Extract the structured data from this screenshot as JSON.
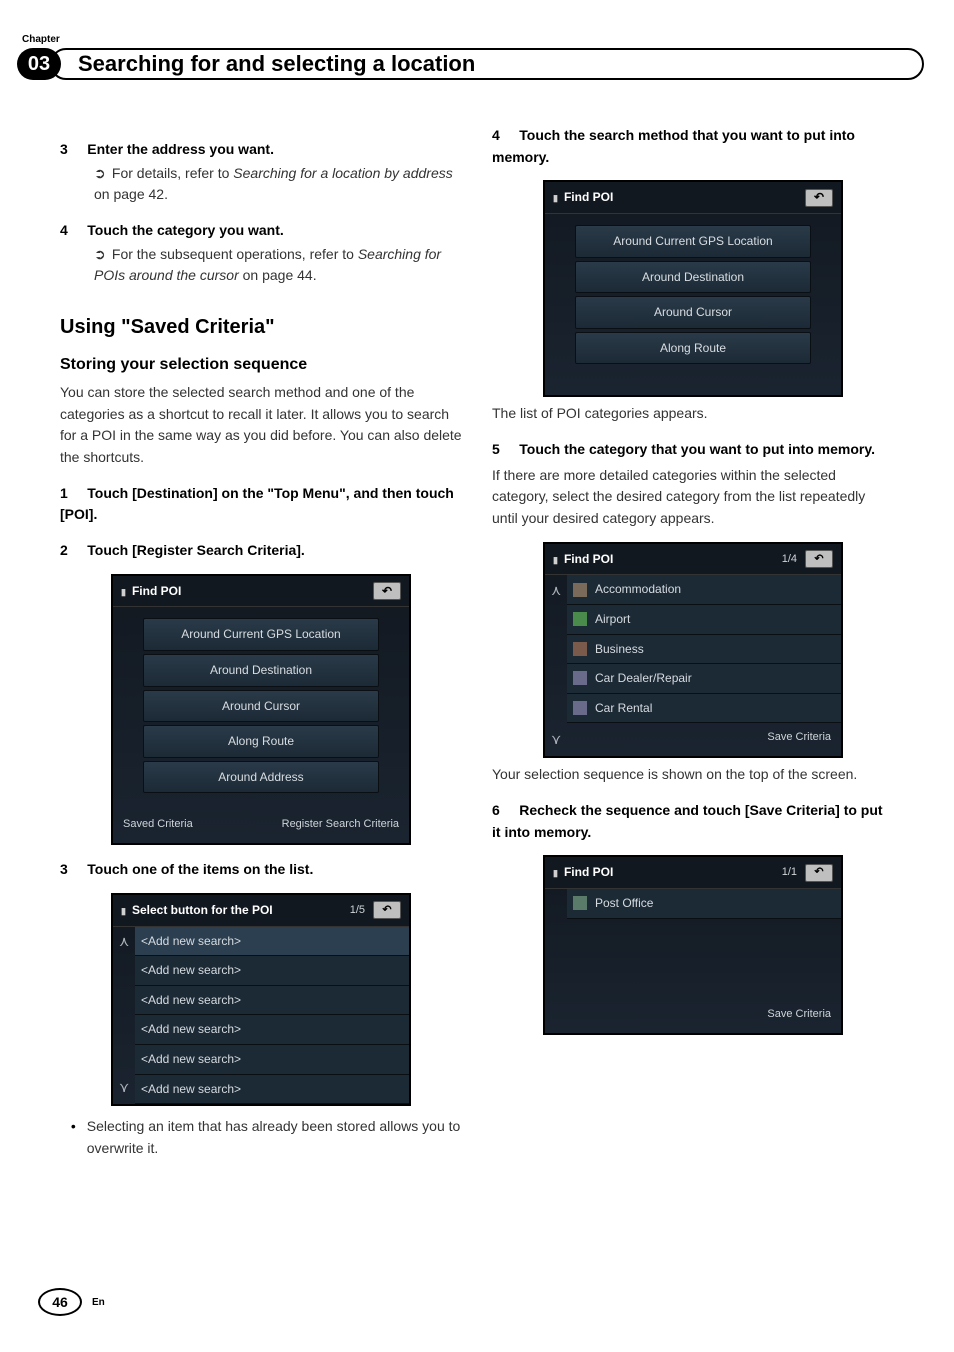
{
  "chapter": {
    "label": "Chapter",
    "number": "03"
  },
  "header": {
    "title": "Searching for and selecting a location"
  },
  "left": {
    "step3": {
      "num": "3",
      "title": "Enter the address you want."
    },
    "step3_sub": {
      "icon": "➲",
      "prefix": "For details, refer to ",
      "link": "Searching for a location by address",
      "suffix": " on page 42."
    },
    "step4": {
      "num": "4",
      "title": "Touch the category you want."
    },
    "step4_sub": {
      "icon": "➲",
      "prefix": "For the subsequent operations, refer to ",
      "link": "Searching for POIs around the cursor",
      "suffix": " on page 44."
    },
    "h2": {
      "prefix": "Using ",
      "quoted": "\"Saved Criteria\""
    },
    "h3": "Storing your selection sequence",
    "para": "You can store the selected search method and one of the categories as a shortcut to recall it later. It allows you to search for a POI in the same way as you did before. You can also delete the shortcuts.",
    "step1": {
      "num": "1",
      "title": "Touch [Destination] on the \"Top Menu\", and then touch [POI]."
    },
    "step2": {
      "num": "2",
      "title": "Touch [Register Search Criteria]."
    },
    "shotA": {
      "title": "Find POI",
      "items": [
        "Around Current GPS Location",
        "Around Destination",
        "Around Cursor",
        "Along Route",
        "Around Address"
      ],
      "footer_left": "Saved Criteria",
      "footer_right": "Register Search Criteria"
    },
    "step3b": {
      "num": "3",
      "title": "Touch one of the items on the list."
    },
    "shotB": {
      "title": "Select button for the POI",
      "page": "1/5",
      "rows": [
        "<Add new search>",
        "<Add new search>",
        "<Add new search>",
        "<Add new search>",
        "<Add new search>",
        "<Add new search>"
      ]
    },
    "bullet": "Selecting an item that has already been stored allows you to overwrite it."
  },
  "right": {
    "step4": {
      "num": "4",
      "title": "Touch the search method that you want to put into memory."
    },
    "shotC": {
      "title": "Find POI",
      "items": [
        "Around Current GPS Location",
        "Around Destination",
        "Around Cursor",
        "Along Route"
      ]
    },
    "after_shotC": "The list of POI categories appears.",
    "step5": {
      "num": "5",
      "title": "Touch the category that you want to put into memory."
    },
    "step5_para": "If there are more detailed categories within the selected category, select the desired category from the list repeatedly until your desired category appears.",
    "shotD": {
      "title": "Find POI",
      "page": "1/4",
      "rows": [
        "Accommodation",
        "Airport",
        "Business",
        "Car Dealer/Repair",
        "Car Rental"
      ],
      "footer_right": "Save Criteria"
    },
    "after_shotD": "Your selection sequence is shown on the top of the screen.",
    "step6": {
      "num": "6",
      "title": "Recheck the sequence and touch [Save Criteria] to put it into memory."
    },
    "shotE": {
      "title": "Find POI",
      "page": "1/1",
      "rows": [
        "Post Office"
      ],
      "footer_right": "Save Criteria"
    }
  },
  "footer": {
    "page": "46",
    "lang": "En"
  }
}
